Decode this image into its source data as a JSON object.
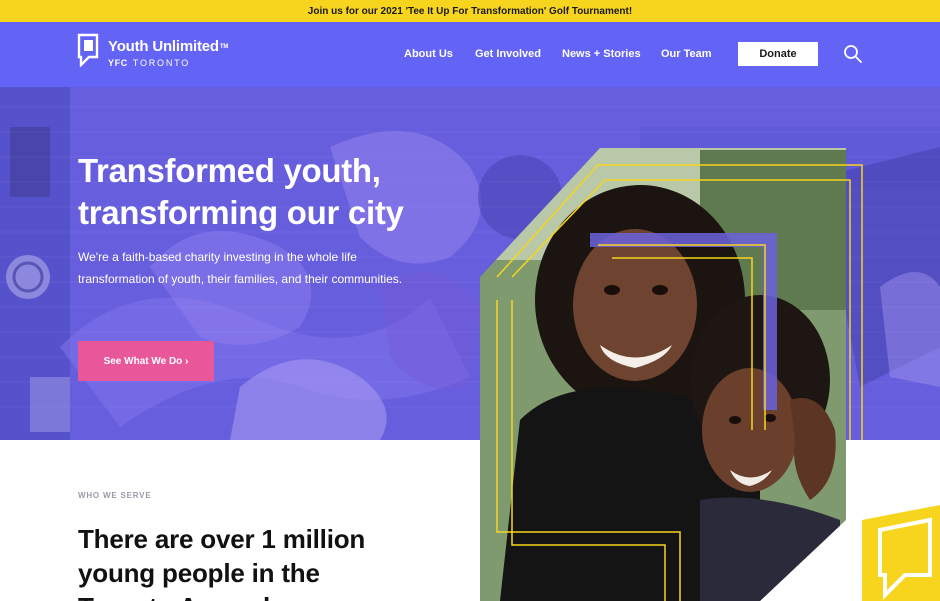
{
  "announcement": {
    "text": "Join us for our 2021 'Tee It Up For Transformation' Golf Tournament!"
  },
  "header": {
    "logo": {
      "name": "Youth Unlimited",
      "trademark": "TM",
      "sub_bold": "YFC",
      "sub_city": "TORONTO"
    },
    "nav": [
      {
        "label": "About Us"
      },
      {
        "label": "Get Involved"
      },
      {
        "label": "News + Stories"
      },
      {
        "label": "Our Team"
      }
    ],
    "donate_label": "Donate",
    "search_icon": "search-icon"
  },
  "hero": {
    "heading_line1": "Transformed youth,",
    "heading_line2": "transforming our city",
    "description": "We're a faith-based charity investing in the whole life transformation of youth, their families, and their communities.",
    "cta_label": "See What We Do ›"
  },
  "who_we_serve": {
    "label": "WHO WE SERVE",
    "heading_line1": "There are over 1 million",
    "heading_line2": "young people in the",
    "heading_line3": "Toronto Area who"
  },
  "colors": {
    "announcement_bg": "#f7d51e",
    "header_bg": "#6363f5",
    "cta_bg": "#e9579b",
    "accent_yellow": "#f7d51e",
    "text_dark": "#111111"
  }
}
